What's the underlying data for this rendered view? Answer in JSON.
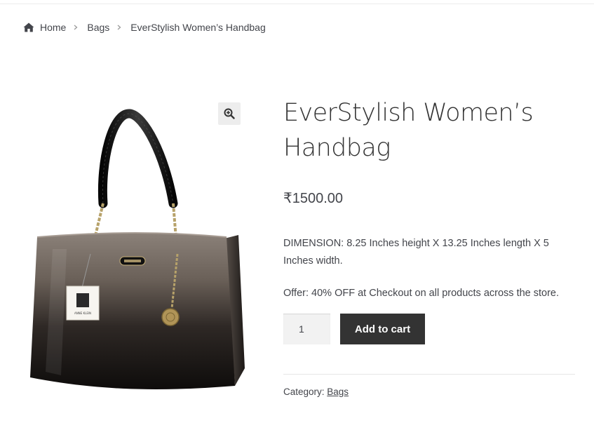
{
  "breadcrumb": {
    "home_icon": "home-icon",
    "home": "Home",
    "bags": "Bags",
    "current": "EverStylish Women’s Handbag"
  },
  "gallery": {
    "zoom_icon": "zoom-in-icon",
    "tag_text": "ANNE KLEIN"
  },
  "product": {
    "title_line1": "EverStylish Women’s",
    "title_line2": "Handbag",
    "price": "₹1500.00",
    "description": "DIMENSION: 8.25 Inches height X 13.25 Inches length X 5 Inches width.",
    "offer": "Offer: 40% OFF at Checkout on all products across the store.",
    "quantity": "1",
    "add_to_cart": "Add to cart",
    "category_label": "Category: ",
    "category_value": "Bags"
  },
  "colors": {
    "text": "#43454b",
    "button_bg": "#333333",
    "button_text": "#ffffff",
    "input_bg": "#f2f2f2"
  }
}
